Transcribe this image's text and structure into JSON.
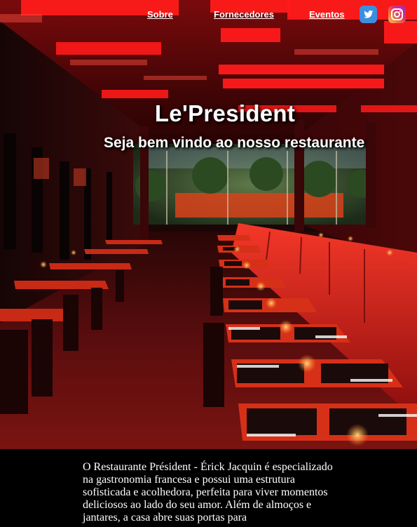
{
  "nav": {
    "links": [
      {
        "label": "Sobre"
      },
      {
        "label": "Fornecedores"
      },
      {
        "label": "Eventos"
      }
    ],
    "social": [
      {
        "icon": "twitter-icon",
        "color": "#3c8fe0"
      },
      {
        "icon": "instagram-icon",
        "color": "#e0306a"
      }
    ]
  },
  "hero": {
    "title": "Le'President",
    "subtitle": "Seja bem vindo ao nosso restaurante",
    "image": "restaurant-interior-photo",
    "accent_color": "#e0101a"
  },
  "about": {
    "text": "O Restaurante Président - Érick Jacquin é especializado na gastronomia francesa e possui uma estrutura sofisticada e acolhedora, perfeita para viver momentos deliciosos ao lado do seu amor. Além de almoços e jantares, a casa abre suas portas para"
  }
}
